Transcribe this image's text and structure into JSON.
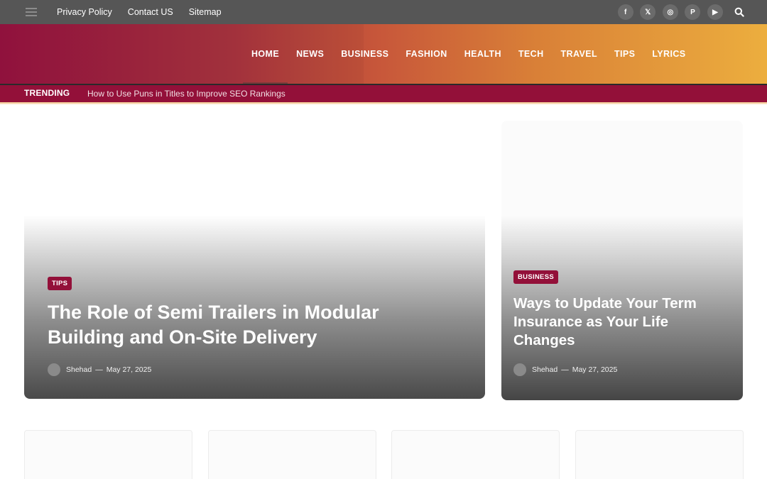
{
  "topbar": {
    "menu_icon": "hamburger-icon",
    "links": [
      "Privacy Policy",
      "Contact US",
      "Sitemap"
    ],
    "socials": [
      {
        "icon": "facebook-icon",
        "glyph": "f"
      },
      {
        "icon": "x-icon",
        "glyph": "𝕏"
      },
      {
        "icon": "instagram-icon",
        "glyph": "◎"
      },
      {
        "icon": "pinterest-icon",
        "glyph": "P"
      },
      {
        "icon": "youtube-icon",
        "glyph": "▶"
      }
    ],
    "search_icon": "search-icon"
  },
  "nav": {
    "items": [
      "HOME",
      "NEWS",
      "BUSINESS",
      "FASHION",
      "HEALTH",
      "TECH",
      "TRAVEL",
      "TIPS",
      "LYRICS"
    ],
    "active": "HOME"
  },
  "trending": {
    "label": "TRENDING",
    "headline": "How to Use Puns in Titles to Improve SEO Rankings"
  },
  "featured": {
    "main": {
      "category": "TIPS",
      "title": "The Role of Semi Trailers in Modular Building and On-Site Delivery",
      "author": "Shehad",
      "separator": "—",
      "date": "May 27, 2025"
    },
    "side": {
      "category": "BUSINESS",
      "title": "Ways to Update Your Term Insurance as Your Life Changes",
      "author": "Shehad",
      "separator": "—",
      "date": "May 27, 2025"
    }
  },
  "colors": {
    "brand": "#931039",
    "gradient_start": "#961240",
    "gradient_end": "#ecae3e",
    "topbar": "#565656"
  }
}
